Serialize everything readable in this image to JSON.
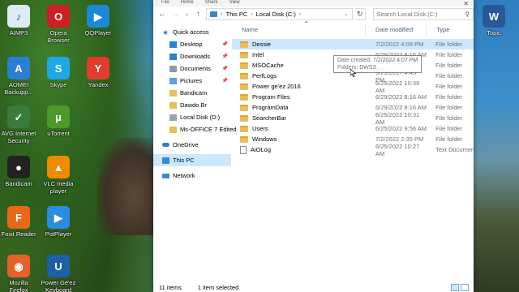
{
  "desktop_icons": [
    {
      "label": "AIMP3",
      "icon": "aimp-icon",
      "color": "#e0eaf5"
    },
    {
      "label": "Opera Browser",
      "icon": "opera-icon",
      "color": "#cc1f26"
    },
    {
      "label": "QQPlayer",
      "icon": "qqplayer-icon",
      "color": "#1b89d6"
    },
    {
      "label": "AOMEI Backupp...",
      "icon": "aomei-icon",
      "color": "#2a7fd4"
    },
    {
      "label": "Skype",
      "icon": "skype-icon",
      "color": "#1ea8e6"
    },
    {
      "label": "Yandex",
      "icon": "yandex-icon",
      "color": "#e23c2c"
    },
    {
      "label": "AVG Internet Security",
      "icon": "avg-icon",
      "color": "#3a7a3a"
    },
    {
      "label": "uTorrent",
      "icon": "utorrent-icon",
      "color": "#4c9a2a"
    },
    {
      "label": "Bandicam",
      "icon": "bandicam-icon",
      "color": "#222222"
    },
    {
      "label": "VLC media player",
      "icon": "vlc-icon",
      "color": "#f08a00"
    },
    {
      "label": "Foxit Reader",
      "icon": "foxit-icon",
      "color": "#e8691b"
    },
    {
      "label": "PotPlayer",
      "icon": "potplayer-icon",
      "color": "#2b8de0"
    },
    {
      "label": "Mozilla Firefox",
      "icon": "firefox-icon",
      "color": "#e6612a"
    },
    {
      "label": "Power Ge'ez Keyboard",
      "icon": "power-geez-icon",
      "color": "#1e5fa8"
    },
    {
      "label": "Topic",
      "icon": "word-doc-icon",
      "color": "#2b579a"
    }
  ],
  "ribbon_tabs": [
    "File",
    "Home",
    "Share",
    "View"
  ],
  "address": {
    "crumbs": [
      "This PC",
      "Local Disk (C:)"
    ],
    "search_placeholder": "Search Local Disk (C:)"
  },
  "nav_pane": {
    "quick_access": "Quick access",
    "pinned": [
      "Desktop",
      "Downloads",
      "Documents",
      "Pictures"
    ],
    "folders": [
      "Bandicam",
      "Dawdo Br",
      "Local Disk (D:)",
      "Ms-OFFICE 7 Edited"
    ],
    "onedrive": "OneDrive",
    "this_pc": "This PC",
    "network": "Network"
  },
  "columns": {
    "name": "Name",
    "date": "Date modified",
    "type": "Type"
  },
  "files": [
    {
      "name": "Dessie",
      "date": "7/2/2022 4:09 PM",
      "type": "File folder",
      "kind": "folder"
    },
    {
      "name": "Intel",
      "date": "6/29/2022 8:16 AM",
      "type": "File folder",
      "kind": "folder"
    },
    {
      "name": "MSOCache",
      "date": "6/25/2022 10:47 AM",
      "type": "File folder",
      "kind": "folder"
    },
    {
      "name": "PerfLogs",
      "date": "9/29/2017 4:45 PM",
      "type": "File folder",
      "kind": "folder"
    },
    {
      "name": "Power ge'ez 2016",
      "date": "6/25/2022 10:39 AM",
      "type": "File folder",
      "kind": "folder"
    },
    {
      "name": "Program Files",
      "date": "6/29/2022 8:16 AM",
      "type": "File folder",
      "kind": "folder"
    },
    {
      "name": "ProgramData",
      "date": "6/29/2022 8:16 AM",
      "type": "File folder",
      "kind": "folder"
    },
    {
      "name": "SearcherBar",
      "date": "6/25/2022 10:31 AM",
      "type": "File folder",
      "kind": "folder"
    },
    {
      "name": "Users",
      "date": "6/25/2022 9:56 AM",
      "type": "File folder",
      "kind": "folder"
    },
    {
      "name": "Windows",
      "date": "7/2/2022 2:35 PM",
      "type": "File folder",
      "kind": "folder"
    },
    {
      "name": "AiOLog",
      "date": "6/25/2022 10:27 AM",
      "type": "Text Document",
      "kind": "file"
    }
  ],
  "tooltip": {
    "line1": "Date created: 7/2/2022 4:07 PM",
    "line2": "Folders: DWSS"
  },
  "status": {
    "items": "11 items",
    "selected": "1 item selected"
  }
}
